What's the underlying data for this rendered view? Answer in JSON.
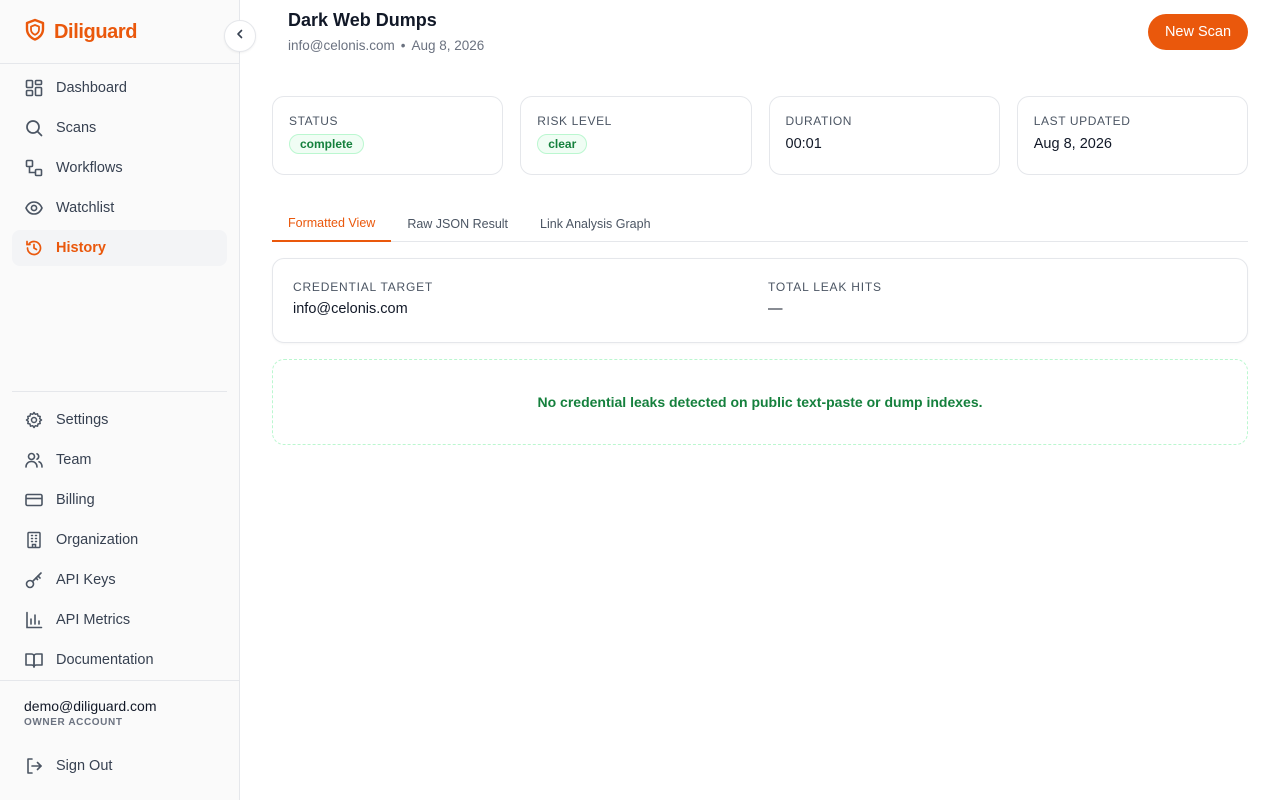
{
  "brand": {
    "name": "Diliguard",
    "accent": "#ea580c"
  },
  "sidebar": {
    "collapse_icon": "chevron-left-icon",
    "main_items": [
      {
        "label": "Dashboard",
        "icon": "dashboard-grid-icon",
        "active": false
      },
      {
        "label": "Scans",
        "icon": "search-icon",
        "active": false
      },
      {
        "label": "Workflows",
        "icon": "workflow-icon",
        "active": false
      },
      {
        "label": "Watchlist",
        "icon": "eye-icon",
        "active": false
      },
      {
        "label": "History",
        "icon": "history-icon",
        "active": true
      }
    ],
    "secondary_items": [
      {
        "label": "Settings",
        "icon": "gear-icon"
      },
      {
        "label": "Team",
        "icon": "users-icon"
      },
      {
        "label": "Billing",
        "icon": "credit-card-icon"
      },
      {
        "label": "Organization",
        "icon": "building-icon"
      },
      {
        "label": "API Keys",
        "icon": "key-icon"
      },
      {
        "label": "API Metrics",
        "icon": "bar-chart-icon"
      },
      {
        "label": "Documentation",
        "icon": "book-icon"
      }
    ],
    "account": {
      "email": "demo@diliguard.com",
      "role": "OWNER ACCOUNT"
    },
    "sign_out": {
      "label": "Sign Out",
      "icon": "sign-out-icon"
    }
  },
  "header": {
    "title": "Dark Web Dumps",
    "target": "info@celonis.com",
    "separator": "•",
    "date": "Aug 8, 2026",
    "new_scan_label": "New Scan"
  },
  "stats": {
    "status": {
      "label": "STATUS",
      "value": "complete"
    },
    "risk": {
      "label": "RISK LEVEL",
      "value": "clear"
    },
    "duration": {
      "label": "DURATION",
      "value": "00:01"
    },
    "updated": {
      "label": "LAST UPDATED",
      "value": "Aug 8, 2026"
    }
  },
  "tabs": [
    {
      "label": "Formatted View",
      "active": true
    },
    {
      "label": "Raw JSON Result",
      "active": false
    },
    {
      "label": "Link Analysis Graph",
      "active": false
    }
  ],
  "detail": {
    "target_label": "CREDENTIAL TARGET",
    "target_value": "info@celonis.com",
    "hits_label": "TOTAL LEAK HITS",
    "hits_value": "—"
  },
  "notice": {
    "text": "No credential leaks detected on public text-paste or dump indexes.",
    "color": "#15803d"
  }
}
